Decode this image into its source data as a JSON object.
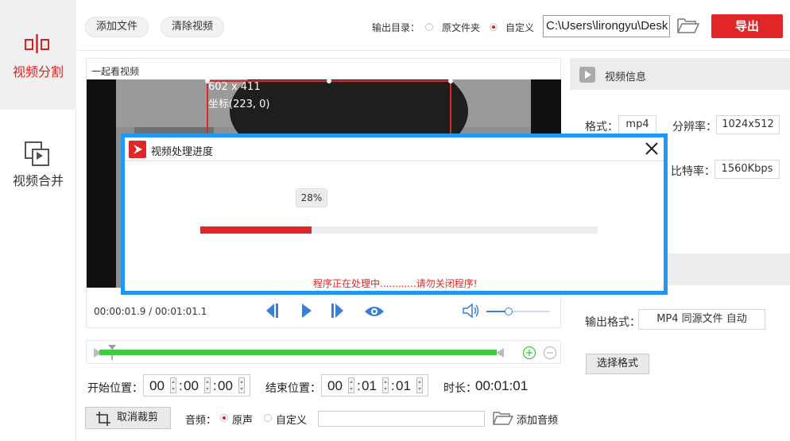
{
  "nav": {
    "split_label": "视频分割",
    "merge_label": "视频合并"
  },
  "toolbar": {
    "add_file": "添加文件",
    "clear_video": "清除视频",
    "output_dir_label": "输出目录：",
    "opt_source_folder": "原文件夹",
    "opt_custom": "自定义",
    "output_path": "C:\\Users\\lirongyu\\Desk",
    "export": "导出"
  },
  "player": {
    "title": "一起看视频",
    "overlay_size": "602 x 411",
    "overlay_coord": "坐标(223, 0)",
    "time_display": "00:00:01.9 / 00:01:01.1",
    "volume_level": 0.35
  },
  "video_info": {
    "header": "视频信息",
    "format_label": "格式：",
    "format_value": "mp4",
    "resolution_label": "分辨率：",
    "resolution_value": "1024x512",
    "bitrate_label": "比特率：",
    "bitrate_value": "1560Kbps",
    "output_format_label": "输出格式：",
    "output_format_value": "MP4 同源文件 自动",
    "choose_format": "选择格式"
  },
  "modal": {
    "title": "视频处理进度",
    "percent_text": "28%",
    "progress": 0.28,
    "status": "程序正在处理中............请勿关闭程序!"
  },
  "range": {
    "start_label": "开始位置：",
    "start": [
      "00",
      "00",
      "00"
    ],
    "end_label": "结束位置：",
    "end": [
      "00",
      "01",
      "01"
    ],
    "duration_label": "时长：",
    "duration_value": "00:01:01"
  },
  "bottom": {
    "cancel_crop": "取消裁剪",
    "audio_label": "音频：",
    "audio_original": "原声",
    "audio_custom": "自定义",
    "add_audio": "添加音频"
  },
  "colors": {
    "accent_red": "#e02626",
    "modal_border": "#2196f3",
    "timeline_green": "#3dcc3d",
    "icon_blue": "#3a7fd5"
  }
}
